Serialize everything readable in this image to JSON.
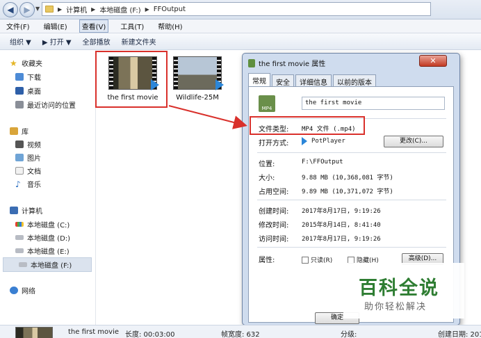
{
  "address": {
    "crumbs": [
      "计算机",
      "本地磁盘 (F:)",
      "FFOutput"
    ]
  },
  "menu": [
    {
      "label": "文件(F)"
    },
    {
      "label": "编辑(E)"
    },
    {
      "label": "查看(V)",
      "active": true
    },
    {
      "label": "工具(T)"
    },
    {
      "label": "帮助(H)"
    }
  ],
  "toolbar": {
    "organize": "组织 ▼",
    "open": "▶ 打开 ▼",
    "play_all": "全部播放",
    "new_folder": "新建文件夹"
  },
  "sidebar": {
    "favorites": "收藏夹",
    "downloads": "下载",
    "desktop": "桌面",
    "recent": "最近访问的位置",
    "libraries": "库",
    "videos": "视频",
    "pictures": "图片",
    "documents": "文档",
    "music": "音乐",
    "computer": "计算机",
    "drive_c": "本地磁盘 (C:)",
    "drive_d": "本地磁盘 (D:)",
    "drive_e": "本地磁盘 (E:)",
    "drive_f": "本地磁盘 (F:)",
    "network": "网络"
  },
  "files": [
    {
      "name": "the first movie"
    },
    {
      "name": "Wildlife-25M"
    }
  ],
  "dialog": {
    "title": "the first movie 属性",
    "close": "✕",
    "tabs": [
      "常规",
      "安全",
      "详细信息",
      "以前的版本"
    ],
    "file_name": "the first movie",
    "file_icon_text": "MP4",
    "labels": {
      "file_type": "文件类型:",
      "opens_with": "打开方式:",
      "location": "位置:",
      "size": "大小:",
      "size_on_disk": "占用空间:",
      "created": "创建时间:",
      "modified": "修改时间:",
      "accessed": "访问时间:",
      "attributes": "属性:"
    },
    "values": {
      "file_type": "MP4 文件 (.mp4)",
      "opens_with": "PotPlayer",
      "location": "F:\\FFOutput",
      "size": "9.88 MB (10,368,081 字节)",
      "size_on_disk": "9.89 MB (10,371,072 字节)",
      "created": "2017年8月17日, 9:19:26",
      "modified": "2015年8月14日, 8:41:40",
      "accessed": "2017年8月17日, 9:19:26"
    },
    "buttons": {
      "change": "更改(C)...",
      "advanced": "高级(D)...",
      "ok": "确定"
    },
    "attributes": {
      "readonly": "只读(R)",
      "hidden": "隐藏(H)"
    }
  },
  "watermark": {
    "main": "百科全说",
    "sub": "助你轻松解决"
  },
  "status": {
    "name": "the first movie",
    "duration": "长度: 00:03:00",
    "frame_width": "帧宽度: 632",
    "rating": "分级:",
    "created": "创建日期: 201"
  },
  "colors": {
    "highlight": "#d9302b",
    "watermark_green": "#2e7d32"
  }
}
